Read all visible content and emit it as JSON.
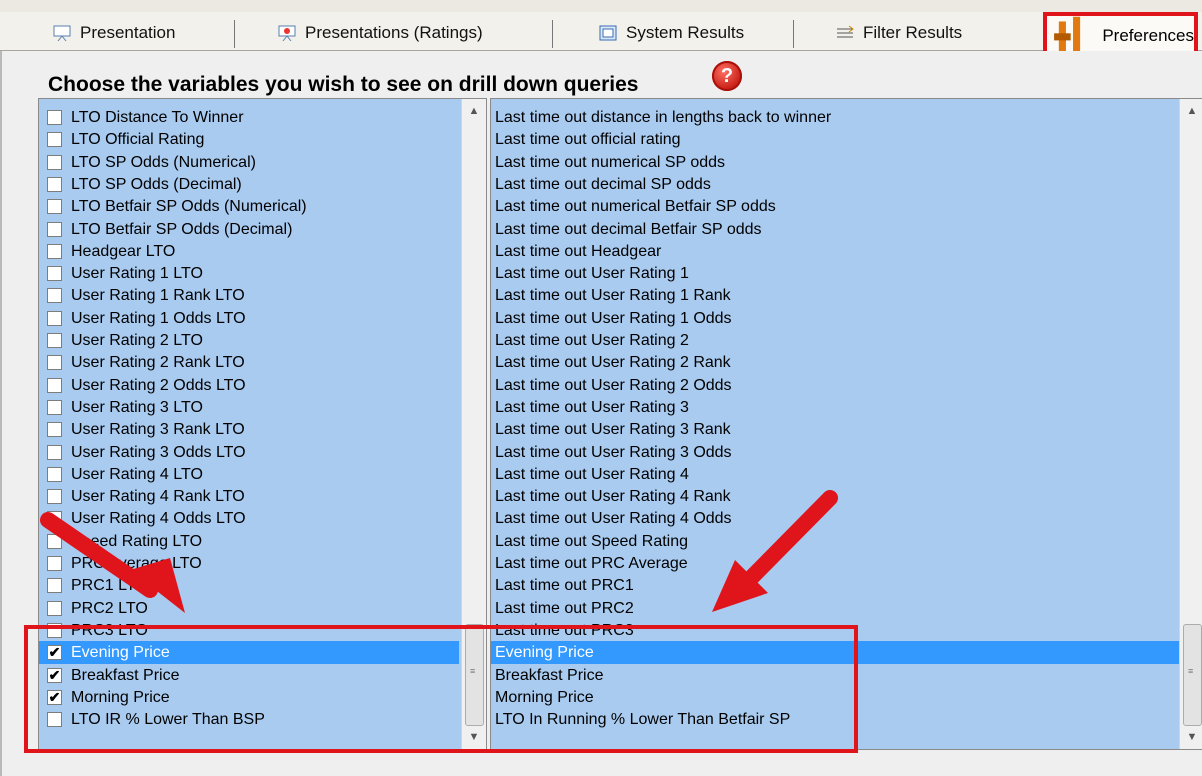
{
  "tabs": {
    "presentation": "Presentation",
    "presentations_ratings": "Presentations (Ratings)",
    "system_results": "System Results",
    "filter_results": "Filter Results",
    "preferences": "Preferences"
  },
  "heading": "Choose the variables you wish to see on drill down queries",
  "help_glyph": "?",
  "left_items": [
    {
      "label": "LTO Distance To Winner",
      "checked": false
    },
    {
      "label": "LTO Official Rating",
      "checked": false
    },
    {
      "label": "LTO SP Odds (Numerical)",
      "checked": false
    },
    {
      "label": "LTO SP Odds (Decimal)",
      "checked": false
    },
    {
      "label": "LTO Betfair SP Odds (Numerical)",
      "checked": false
    },
    {
      "label": "LTO Betfair SP Odds (Decimal)",
      "checked": false
    },
    {
      "label": "Headgear LTO",
      "checked": false
    },
    {
      "label": "User Rating 1 LTO",
      "checked": false
    },
    {
      "label": "User Rating 1 Rank LTO",
      "checked": false
    },
    {
      "label": "User Rating 1 Odds LTO",
      "checked": false
    },
    {
      "label": "User Rating 2 LTO",
      "checked": false
    },
    {
      "label": "User Rating 2 Rank LTO",
      "checked": false
    },
    {
      "label": "User Rating 2 Odds LTO",
      "checked": false
    },
    {
      "label": "User Rating 3 LTO",
      "checked": false
    },
    {
      "label": "User Rating 3 Rank LTO",
      "checked": false
    },
    {
      "label": "User Rating 3 Odds LTO",
      "checked": false
    },
    {
      "label": "User Rating 4 LTO",
      "checked": false
    },
    {
      "label": "User Rating 4 Rank LTO",
      "checked": false
    },
    {
      "label": "User Rating 4 Odds LTO",
      "checked": false
    },
    {
      "label": "Speed Rating LTO",
      "checked": false
    },
    {
      "label": "PRC Average LTO",
      "checked": false
    },
    {
      "label": "PRC1 LTO",
      "checked": false
    },
    {
      "label": "PRC2 LTO",
      "checked": false
    },
    {
      "label": "PRC3 LTO",
      "checked": false
    },
    {
      "label": "Evening Price",
      "checked": true,
      "selected": true
    },
    {
      "label": "Breakfast Price",
      "checked": true
    },
    {
      "label": "Morning Price",
      "checked": true
    },
    {
      "label": "LTO IR % Lower Than BSP",
      "checked": false
    }
  ],
  "right_items": [
    "Last time out distance in lengths back to winner",
    "Last time out official rating",
    "Last time out numerical SP odds",
    "Last time out decimal SP odds",
    "Last time out numerical Betfair SP odds",
    "Last time out decimal Betfair SP odds",
    "Last time out Headgear",
    "Last time out User Rating 1",
    "Last time out User Rating 1 Rank",
    "Last time out User Rating 1 Odds",
    "Last time out User Rating 2",
    "Last time out User Rating 2 Rank",
    "Last time out User Rating 2 Odds",
    "Last time out User Rating 3",
    "Last time out User Rating 3 Rank",
    "Last time out User Rating 3 Odds",
    "Last time out User Rating 4",
    "Last time out User Rating 4 Rank",
    "Last time out User Rating 4 Odds",
    "Last time out Speed Rating",
    "Last time out PRC Average",
    "Last time out PRC1",
    "Last time out PRC2",
    "Last time out PRC3",
    "Evening Price",
    "Breakfast Price",
    "Morning Price",
    "LTO In Running % Lower Than Betfair SP"
  ],
  "colors": {
    "list_bg": "#a9cbf0",
    "selection": "#3399ff",
    "annotation": "#e0141b"
  }
}
